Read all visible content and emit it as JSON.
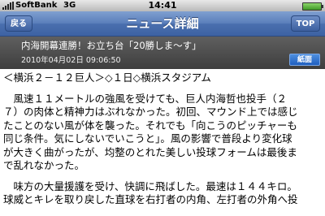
{
  "status_bar": {
    "carrier": "SoftBank",
    "network": "3G",
    "time": "14:41"
  },
  "nav": {
    "back_label": "戻る",
    "title": "ニュース詳細",
    "top_label": "TOP"
  },
  "article": {
    "headline": "内海開幕連勝！お立ち台「20勝しま～す」",
    "date": "2010年04月02日 09:06:50",
    "paper_button": "紙面",
    "dateline": "＜横浜２－１２巨人＞◇１日◇横浜スタジアム",
    "paragraphs": [
      {
        "lines": [
          "　風速１１メートルの強風を受けても、巨人内海哲也投手（２",
          "７）の肉体と精神力はぶれなかった。初回、マウンド上では感じ",
          "たことのない風が体を襲った。それでも「向こうのピッチャーも",
          "同じ条件。気にしないでいこうと」。風の影響で普段より変化球",
          "が大きく曲がったが、均整のとれた美しい投球フォームは最後ま",
          "で乱れなかった。"
        ]
      },
      {
        "lines": [
          "　味方の大量援護を受け、快調に飛ばした。最速は１４４キロ。",
          "球威とキレを取り戻した直球を右打者の内角、左打者の外角へ投"
        ]
      }
    ]
  }
}
